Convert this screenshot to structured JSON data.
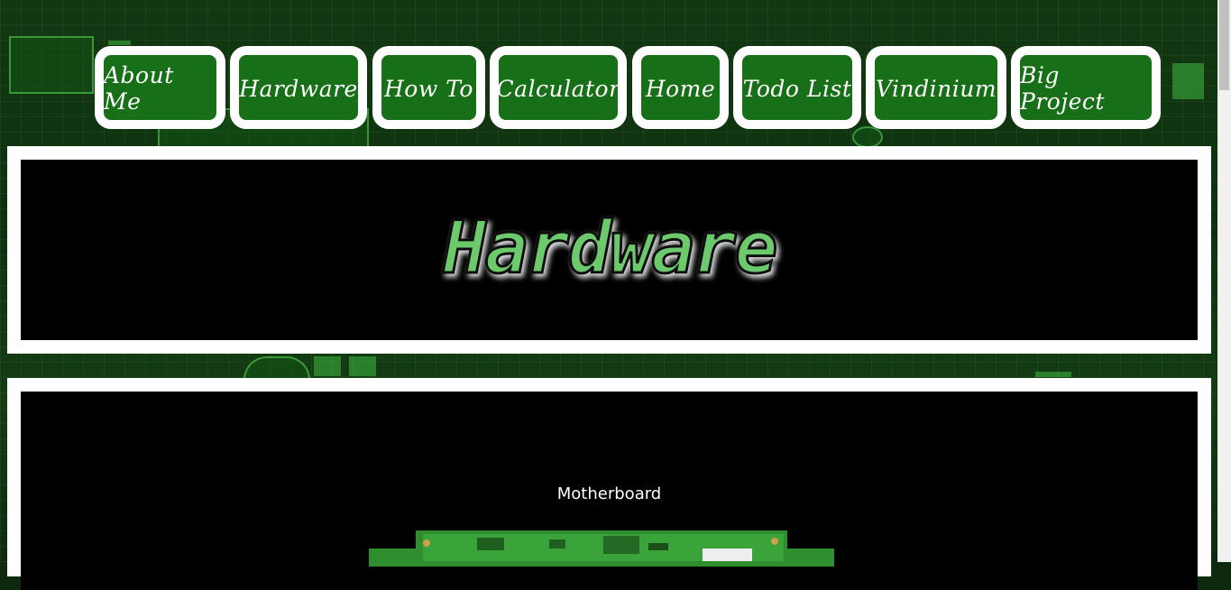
{
  "nav": {
    "items": [
      {
        "label": "About Me"
      },
      {
        "label": "Hardware"
      },
      {
        "label": "How To"
      },
      {
        "label": "Calculator"
      },
      {
        "label": "Home"
      },
      {
        "label": "Todo List"
      },
      {
        "label": "Vindinium"
      },
      {
        "label": "Big Project"
      }
    ]
  },
  "header": {
    "logo_text": "Hardware"
  },
  "content": {
    "section_title": "Motherboard"
  },
  "colors": {
    "nav_button_bg": "#177017",
    "logo_fill": "#6cc96c",
    "panel_border": "#ffffff",
    "panel_bg": "#000000"
  }
}
